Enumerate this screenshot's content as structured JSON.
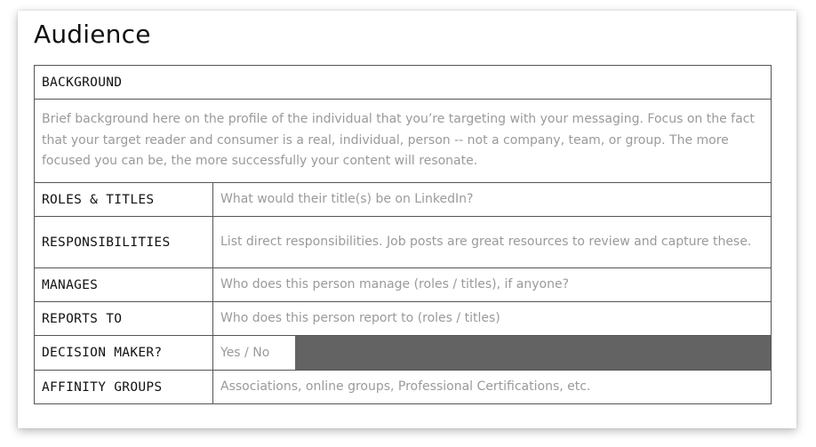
{
  "title": "Audience",
  "background": {
    "header": "BACKGROUND",
    "text": "Brief background here on the profile of the individual that you’re targeting with your messaging. Focus on the fact that your target reader and consumer is a real, individual, person -- not a company, team, or group. The more focused you can be, the more successfully your content will resonate."
  },
  "rows": [
    {
      "label": "ROLES & TITLES",
      "hint": "What would their title(s) be on LinkedIn?"
    },
    {
      "label": "RESPONSIBILITIES",
      "hint": "List direct responsibilities. Job posts are great resources to review and capture these."
    },
    {
      "label": "MANAGES",
      "hint": "Who does this person manage (roles / titles), if anyone?"
    },
    {
      "label": "REPORTS TO",
      "hint": "Who does this person report to (roles / titles)"
    },
    {
      "label": "DECISION MAKER?",
      "hint": "Yes / No"
    },
    {
      "label": "AFFINITY GROUPS",
      "hint": "Associations, online groups, Professional Certifications, etc."
    }
  ],
  "colors": {
    "border": "#555555",
    "hint_text": "#9a9a9a",
    "decision_fill": "#636363"
  }
}
